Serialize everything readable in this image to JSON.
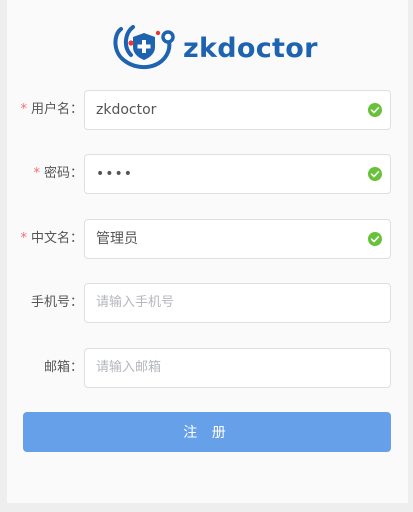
{
  "brand": {
    "name": "zkdoctor",
    "accent": "#1e63b0",
    "icon": "stethoscope-shield-icon"
  },
  "form": {
    "required_mark": "*",
    "fields": [
      {
        "label": "用户名：",
        "value": "zkdoctor",
        "required": true,
        "valid": true
      },
      {
        "label": "密码：",
        "value": "••••",
        "required": true,
        "valid": true
      },
      {
        "label": "中文名：",
        "value": "管理员",
        "required": true,
        "valid": true
      },
      {
        "label": "手机号：",
        "placeholder": "请输入手机号",
        "required": false
      },
      {
        "label": "邮箱：",
        "placeholder": "请输入邮箱",
        "required": false
      }
    ],
    "submit_label": "注 册"
  },
  "colors": {
    "valid": "#67c23a",
    "required": "#f56c6c",
    "button": "#66a0e8"
  }
}
